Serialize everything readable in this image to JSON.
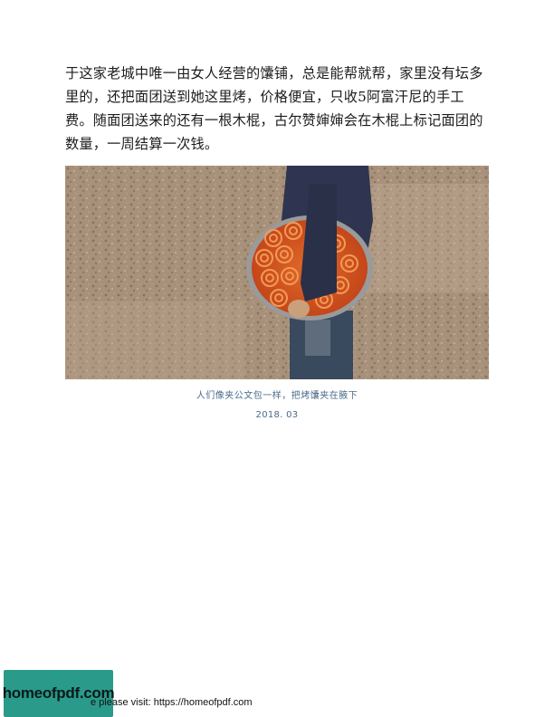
{
  "body_text": "于这家老城中唯一由女人经营的馕铺，总是能帮就帮，家里没有坛多里的，还把面团送到她这里烤，价格便宜，只收5阿富汗尼的手工费。随面团送来的还有一根木棍，古尔赞婶婶会在木棍上标记面团的数量，一周结算一次钱。",
  "photo": {
    "icon": "photo-man-carrying-bread-tray"
  },
  "caption": "人们像夹公文包一样，把烤馕夹在腋下",
  "date": "2018. 03",
  "footer": {
    "text": "e please visit: https://homeofpdf.com",
    "logo_text": "homeofpdf.com",
    "logo_color": "#2a9a8a"
  }
}
